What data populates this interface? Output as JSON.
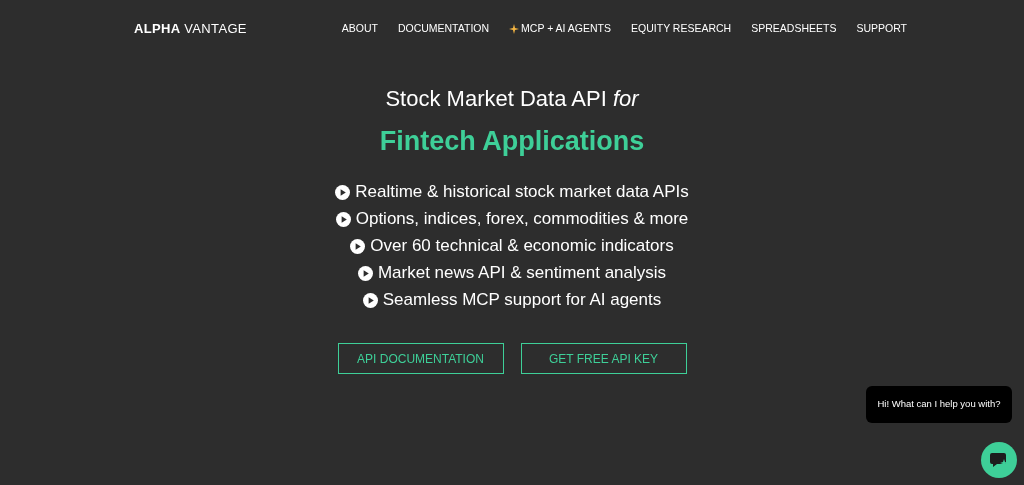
{
  "header": {
    "logo": "**ALPHA** VANTAGE",
    "nav": [
      {
        "label": "ABOUT",
        "kind": "plain"
      },
      {
        "label": "DOCUMENTATION",
        "kind": "plain"
      },
      {
        "label": "MCP + AI AGENTS",
        "kind": "sparkle"
      },
      {
        "label": "EQUITY RESEARCH",
        "kind": "plain"
      },
      {
        "label": "SPREADSHEETS",
        "kind": "plain"
      },
      {
        "label": "SUPPORT",
        "kind": "plain"
      }
    ]
  },
  "hero": {
    "title": "Stock Market Data API *for*",
    "subtitle": "Fintech Applications",
    "features": [
      "Realtime & historical stock market data APIs",
      "Options, indices, forex, commodities & more",
      "Over 60 technical & economic indicators",
      "Market news API & sentiment analysis",
      "Seamless MCP support for AI agents"
    ],
    "buttons": [
      "API DOCUMENTATION",
      "GET FREE API KEY"
    ]
  },
  "chat": {
    "greeting": "Hi! What can I help you with?"
  }
}
